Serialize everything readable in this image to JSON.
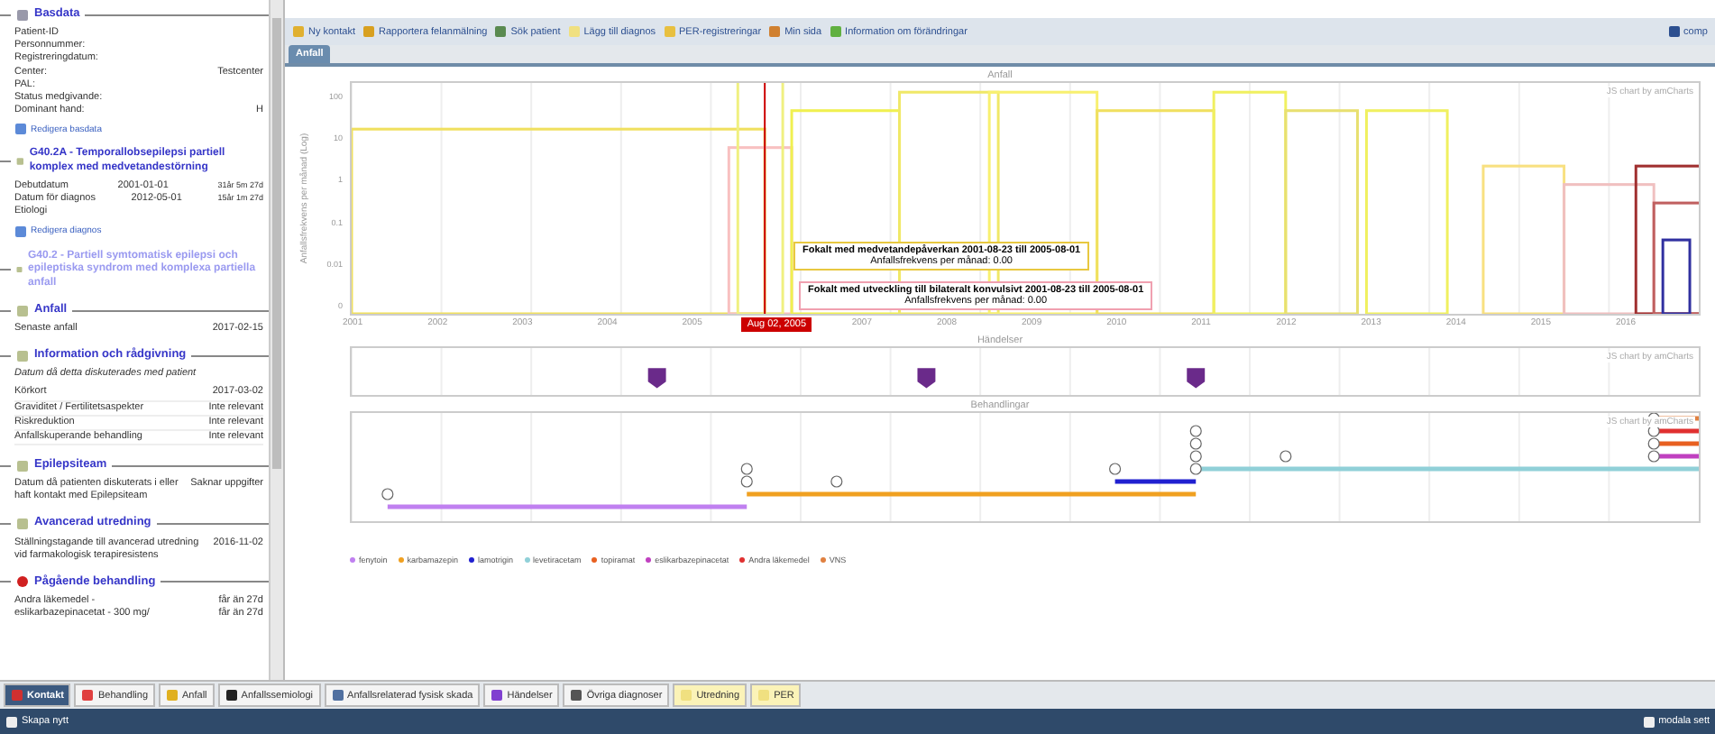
{
  "sidebar": {
    "sections": [
      {
        "kind": "basdata",
        "title": "Basdata",
        "rows": [
          {
            "label": "Patient-ID"
          },
          {
            "label": "Personnummer:"
          },
          {
            "label": "Registreringdatum:"
          },
          {
            "label": "Center:",
            "value": "Testcenter"
          },
          {
            "label": "PAL:"
          },
          {
            "label": "Status medgivande:"
          },
          {
            "label": "Dominant hand:",
            "value": "H"
          }
        ],
        "link": "Redigera basdata"
      },
      {
        "kind": "diagnosis",
        "dimmed": false,
        "title": "G40.2A - Temporallobsepilepsi partiell komplex med medvetandestörning",
        "rows": [
          {
            "label": "Debutdatum",
            "value": "2001-01-01",
            "note": "31år 5m 27d"
          },
          {
            "label": "Datum för diagnos",
            "value": "2012-05-01",
            "note": "15år 1m 27d"
          },
          {
            "label": "Etiologi"
          }
        ],
        "link": "Redigera diagnos"
      },
      {
        "kind": "diagnosis",
        "dimmed": true,
        "title": "G40.2 - Partiell symtomatisk epilepsi och epileptiska syndrom med komplexa partiella anfall"
      },
      {
        "kind": "plain",
        "title": "Anfall",
        "rows": [
          {
            "label": "Senaste anfall",
            "value": "2017-02-15"
          }
        ]
      },
      {
        "kind": "plain",
        "title": "Information och rådgivning",
        "subtitle": "Datum då detta diskuterades med patient",
        "rows": [
          {
            "label": "Körkort",
            "value": "2017-03-02"
          },
          {
            "label": "Graviditet / Fertilitetsaspekter",
            "value": "Inte relevant"
          },
          {
            "label": "Riskreduktion",
            "value": "Inte relevant"
          },
          {
            "label": "Anfallskuperande behandling",
            "value": "Inte relevant"
          }
        ]
      },
      {
        "kind": "plain",
        "title": "Epilepsiteam",
        "rows": [
          {
            "label": "Datum då patienten diskuterats i eller haft kontakt med Epilepsiteam",
            "value": "Saknar uppgifter"
          }
        ]
      },
      {
        "kind": "plain",
        "title": "Avancerad utredning",
        "rows": [
          {
            "label": "Ställningstagande till avancerad utredning vid farmakologisk terapiresistens",
            "value": "2016-11-02"
          }
        ]
      },
      {
        "kind": "current",
        "title": "Pågående behandling",
        "rows": [
          {
            "label": "Andra läkemedel -",
            "value": "får än 27d"
          },
          {
            "label": "eslikarbazepinacetat - 300 mg/",
            "value": "får än 27d"
          }
        ]
      }
    ]
  },
  "toolbar": {
    "items": [
      "Ny kontakt",
      "Rapportera felanmälning",
      "Sök patient",
      "Lägg till diagnos",
      "PER-registreringar",
      "Min sida",
      "Information om förändringar"
    ],
    "right": "comp"
  },
  "tabs": [
    {
      "label": "Anfall",
      "selected": true
    }
  ],
  "seizure_chart": {
    "title": "Anfall",
    "ylabel": "Anfallsfrekvens per månad (Log)",
    "yticks": [
      "100",
      "10",
      "1",
      "0.1",
      "0.01",
      "0"
    ],
    "xticks": [
      "2001",
      "2002",
      "2003",
      "2004",
      "2005",
      "2007",
      "2008",
      "2009",
      "2010",
      "2011",
      "2012",
      "2013",
      "2014",
      "2015",
      "2016"
    ],
    "cursor_label": "Aug 02, 2005",
    "credit": "JS chart by amCharts",
    "tooltips": [
      {
        "title": "Fokalt med medvetandepåverkan 2001-08-23 till 2005-08-01",
        "text": "Anfallsfrekvens per månad: 0.00",
        "color": "#e8c840"
      },
      {
        "title": "Fokalt med utveckling till bilateralt konvulsivt 2001-08-23 till 2005-08-01",
        "text": "Anfallsfrekvens per månad: 0.00",
        "color": "#f0a0b0"
      }
    ]
  },
  "events_chart": {
    "title": "Händelser",
    "credit": "JS chart by amCharts"
  },
  "treatment_chart": {
    "title": "Behandlingar",
    "credit": "JS chart by amCharts",
    "legend": [
      {
        "label": "fenytoin",
        "color": "#c080f0"
      },
      {
        "label": "karbamazepin",
        "color": "#f0a020"
      },
      {
        "label": "lamotrigin",
        "color": "#2020d0"
      },
      {
        "label": "levetiracetam",
        "color": "#90d0d8"
      },
      {
        "label": "topiramat",
        "color": "#e86020"
      },
      {
        "label": "eslikarbazepinacetat",
        "color": "#c040c0"
      },
      {
        "label": "Andra läkemedel",
        "color": "#e03030"
      },
      {
        "label": "VNS",
        "color": "#e08040"
      }
    ]
  },
  "bottom_tabs": [
    {
      "label": "Kontakt",
      "selected": true,
      "kind": "normal"
    },
    {
      "label": "Behandling",
      "selected": false,
      "kind": "normal"
    },
    {
      "label": "Anfall",
      "selected": false,
      "kind": "normal"
    },
    {
      "label": "Anfallssemiologi",
      "selected": false,
      "kind": "normal"
    },
    {
      "label": "Anfallsrelaterad fysisk skada",
      "selected": false,
      "kind": "normal"
    },
    {
      "label": "Händelser",
      "selected": false,
      "kind": "normal"
    },
    {
      "label": "Övriga diagnoser",
      "selected": false,
      "kind": "normal"
    },
    {
      "label": "Utredning",
      "selected": false,
      "kind": "highlight"
    },
    {
      "label": "PER",
      "selected": false,
      "kind": "highlight"
    }
  ],
  "status_bar": {
    "left": "Skapa nytt",
    "right": "modala sett"
  }
}
